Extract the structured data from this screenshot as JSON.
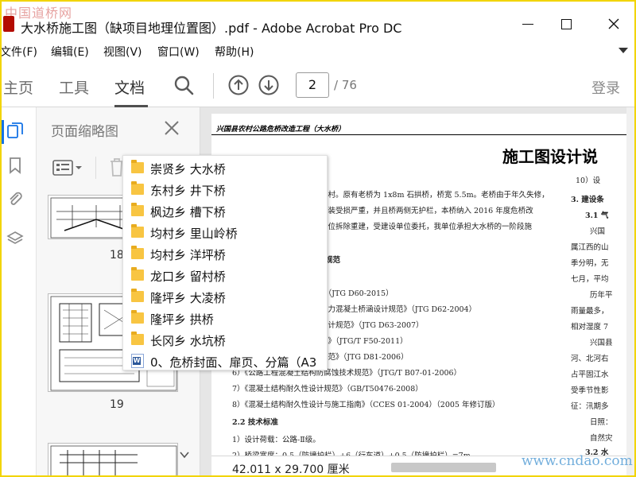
{
  "window": {
    "title": "大水桥施工图（缺项目地理位置图）.pdf - Adobe Acrobat Pro DC",
    "watermark_top": "中国道桥网",
    "watermark_bottom": "www.cndao.com"
  },
  "menu": [
    {
      "label": "文件(F)"
    },
    {
      "label": "编辑(E)"
    },
    {
      "label": "视图(V)"
    },
    {
      "label": "窗口(W)"
    },
    {
      "label": "帮助(H)"
    }
  ],
  "toolbar": {
    "tabs": [
      {
        "label": "主页"
      },
      {
        "label": "工具"
      },
      {
        "label": "文档"
      }
    ],
    "page_current": "2",
    "page_total": "/ 76",
    "login": "登录"
  },
  "thumbnails_panel": {
    "title": "页面缩略图",
    "pages": [
      {
        "label": "18"
      },
      {
        "label": "19"
      }
    ]
  },
  "dropdown": {
    "items": [
      {
        "label": "崇贤乡 大水桥",
        "icon": "folder"
      },
      {
        "label": "东村乡 井下桥",
        "icon": "folder"
      },
      {
        "label": "枫边乡 槽下桥",
        "icon": "folder"
      },
      {
        "label": "均村乡 里山岭桥",
        "icon": "folder"
      },
      {
        "label": "均村乡 洋坪桥",
        "icon": "folder"
      },
      {
        "label": "龙口乡 留村桥",
        "icon": "folder"
      },
      {
        "label": "隆坪乡 大凌桥",
        "icon": "folder"
      },
      {
        "label": "隆坪乡 拱桥",
        "icon": "folder"
      },
      {
        "label": "长冈乡 水坑桥",
        "icon": "folder"
      },
      {
        "label": "0、危桥封面、扉页、分篇（A3",
        "icon": "word"
      }
    ]
  },
  "document": {
    "header": "兴国县农村公路危桥改造工程（大水桥）",
    "title": "施工图设计说",
    "lines": [
      "10）设",
      "3. 建设条",
      "3.1 气",
      "兴国",
      "属江西的山",
      "季分明，无",
      "七月，平均",
      "历年平",
      "雨量最多，",
      "相对湿度 7",
      "兴国县",
      "河、北河右",
      "占平固江水",
      "受季节性影",
      "征：汛期多",
      "日照：",
      "自然灾",
      "3.2 水",
      "乡贺堂村。原有老桥为 1x8m 石拱桥，桥宽 5.5m。老桥由于年久失修，",
      "桥面铺装受损严重，并且桥两侧无护栏，本桥纳入 2016 年度危桥改",
      "在原桥位拆除重建，受建设单位委托，我单位承担大水桥的一阶段施",
      "采用规范",
      "规范》（JTG D60-2015）",
      "及预应力混凝土桥涵设计规范》（JTG D62-2004）",
      "基础设计规范》（JTG D63-2007）",
      "术规范》（JTG/T F50-2011）",
      "设计规范》（JTG D81-2006）",
      "6）《公路工程混凝土结构防腐蚀技术规范》（JTG/T B07-01-2006）",
      "7）《混凝土结构耐久性设计规范》（GB/T50476-2008）",
      "8）《混凝土结构耐久性设计与施工指南》（CCES 01-2004）（2005 年修订版）",
      "2.2 技术标准",
      "1）设计荷载：公路-Ⅱ级。",
      "2）桥梁宽度：0.5（防撞护栏）+6（行车道）+0.5（防撞护栏）=7m"
    ]
  },
  "status": {
    "page_size": "42.011 x 29.700 厘米"
  }
}
